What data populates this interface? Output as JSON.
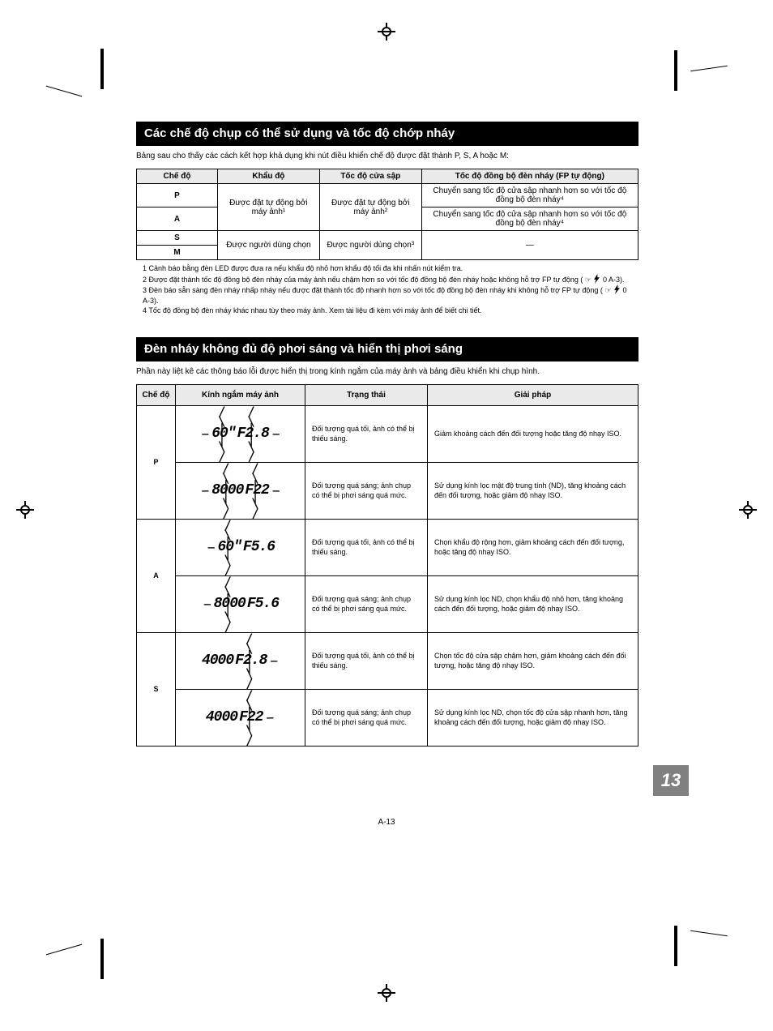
{
  "section1": {
    "title": "Các chế độ chụp có thể sử dụng và tốc độ chớp nháy",
    "intro": "Bảng sau cho thấy các cách kết hợp khả dụng khi nút điều khiển chế độ được đặt thành P, S, A hoặc M:",
    "headers": {
      "mode": "Chế độ",
      "aperture": "Khẩu độ",
      "shutter": "Tốc độ cửa sập",
      "sync": "Tốc độ đồng bộ đèn nháy (FP tự động)"
    },
    "rows": {
      "p": "P",
      "a": "A",
      "s": "S",
      "m": "M"
    },
    "cells": {
      "aperture_auto": "Được đặt tự động bởi máy ảnh¹",
      "aperture_user": "Được người dùng chọn",
      "shutter_auto": "Được đặt tự động bởi máy ảnh²",
      "shutter_user": "Được người dùng chọn³",
      "sync_fast": "Chuyển sang tốc độ cửa sập nhanh hơn so với tốc độ đồng bộ đèn nháy⁴",
      "sync_none": "—"
    },
    "footnotes": {
      "f1_label": "1",
      "f1": "Cảnh báo bằng đèn LED được đưa ra nếu khẩu độ nhỏ hơn khẩu độ tối đa khi nhấn nút kiểm tra.",
      "f2_label": "2",
      "f2": "Được đặt thành tốc độ đồng bộ đèn nháy của máy ảnh nếu chậm hơn so với tốc độ đồng bộ đèn nháy hoặc không hỗ trợ FP tự động (",
      "f2_tail": " 0 A-3).",
      "f3_label": "3",
      "f3": "Đèn báo sẵn sàng đèn nháy nhấp nháy nếu được đặt thành tốc độ nhanh hơn so với tốc độ đồng bộ đèn nháy khi không hỗ trợ FP tự động (",
      "f3_tail": " 0 A-3).",
      "f4_label": "4",
      "f4": "Tốc độ đồng bộ đèn nháy khác nhau tùy theo máy ảnh. Xem tài liệu đi kèm với máy ảnh để biết chi tiết."
    }
  },
  "section2": {
    "title": "Đèn nháy không đủ độ phơi sáng và hiển thị phơi sáng",
    "intro": "Phần này liệt kê các thông báo lỗi được hiển thị trong kính ngắm của máy ảnh và bảng điều khiển khi chụp hình.",
    "headers": {
      "mode": "Chế độ",
      "viewfinder": "Kính ngắm máy ảnh",
      "status": "Trạng thái",
      "solution": "Giải pháp"
    },
    "rows": [
      {
        "mode": "P",
        "lcd1_dashL": "−",
        "lcd1_blink1": "60\"",
        "lcd1_blink2": "F2.8",
        "lcd1_dashR": "−",
        "lcd2_dashL": "−",
        "lcd2_blink1": "8000",
        "lcd2_blink2": "F22",
        "lcd2_dashR": "−",
        "status1": "Đối tượng quá tối, ảnh có thể bị thiếu sáng.",
        "status2": "Đối tượng quá sáng; ảnh chụp có thể bị phơi sáng quá mức.",
        "solution1": "Giảm khoảng cách đến đối tượng hoặc tăng độ nhạy ISO.",
        "solution2": "Sử dụng kính lọc mật độ trung tính (ND), tăng khoảng cách đến đối tượng, hoặc giảm độ nhạy ISO."
      },
      {
        "mode": "A",
        "lcd1_dashL": "−",
        "lcd1_blink1": "60\"",
        "lcd1_plain": "F5.6",
        "lcd2_dashL": "−",
        "lcd2_blink1": "8000",
        "lcd2_plain": "F5.6",
        "status1": "Đối tượng quá tối, ảnh có thể bị thiếu sáng.",
        "status2": "Đối tượng quá sáng; ảnh chụp có thể bị phơi sáng quá mức.",
        "solution1": "Chọn khẩu độ rộng hơn, giảm khoảng cách đến đối tượng, hoặc tăng độ nhạy ISO.",
        "solution2": "Sử dụng kính lọc ND, chọn khẩu độ nhỏ hơn, tăng khoảng cách đến đối tượng, hoặc giảm độ nhạy ISO."
      },
      {
        "mode": "S",
        "lcd1_plain": "4000",
        "lcd1_blink1": "F2.8",
        "lcd1_dashR": "−",
        "lcd2_plain": "4000",
        "lcd2_blink1": "F22",
        "lcd2_dashR": "−",
        "status1": "Đối tượng quá tối, ảnh có thể bị thiếu sáng.",
        "status2": "Đối tượng quá sáng; ảnh chụp có thể bị phơi sáng quá mức.",
        "solution1": "Chọn tốc độ cửa sập chậm hơn, giảm khoảng cách đến đối tượng, hoặc tăng độ nhạy ISO.",
        "solution2": "Sử dụng kính lọc ND, chọn tốc độ cửa sập nhanh hơn, tăng khoảng cách đến đối tượng, hoặc giảm độ nhạy ISO."
      }
    ]
  },
  "pageTab": "13",
  "pageNumber": "A-13"
}
